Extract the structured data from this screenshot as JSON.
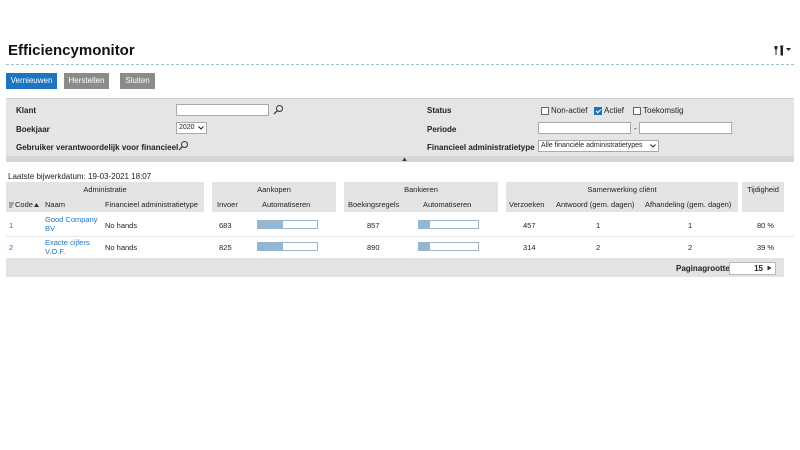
{
  "page": {
    "title": "Efficiencymonitor"
  },
  "toolbar": {
    "refresh_label": "Vernieuwen",
    "reset_label": "Herstellen",
    "close_label": "Sluiten"
  },
  "filters": {
    "client_label": "Klant",
    "client_value": "",
    "fiscal_year_label": "Boekjaar",
    "fiscal_year_value": "2020",
    "responsible_user_label": "Gebruiker verantwoordelijk voor financieel",
    "status_label": "Status",
    "status_options": [
      {
        "label": "Non-actief",
        "checked": false
      },
      {
        "label": "Actief",
        "checked": true
      },
      {
        "label": "Toekomstig",
        "checked": false
      }
    ],
    "period_label": "Periode",
    "period_from": "",
    "period_separator": "-",
    "period_to": "",
    "admin_type_label": "Financieel administratietype",
    "admin_type_value": "Alle financiële administratietypes"
  },
  "last_update": "Laatste bijwerkdatum: 19-03-2021 18:07",
  "table": {
    "groups": {
      "administratie": "Administratie",
      "aankopen": "Aankopen",
      "bankieren": "Bankieren",
      "samenwerking": "Samenwerking cliënt",
      "tijdigheid": "Tijdigheid"
    },
    "columns": {
      "code": "Code",
      "naam": "Naam",
      "fin_type": "Financieel administratietype",
      "invoer": "Invoer",
      "automatiseren_aankopen": "Automatiseren",
      "boekingsregels": "Boekingsregels",
      "automatiseren_bankieren": "Automatiseren",
      "verzoeken": "Verzoeken",
      "antwoord": "Antwoord (gem. dagen)",
      "afhandeling": "Afhandeling (gem. dagen)"
    },
    "rows": [
      {
        "code": "1",
        "naam_line1": "Good Company",
        "naam_line2": "BV",
        "fin_type": "No hands",
        "invoer": "683",
        "aankopen_auto": 0.42,
        "boekingsregels": "857",
        "bankieren_auto": 0.18,
        "verzoeken": "457",
        "antwoord": "1",
        "afhandeling": "1",
        "tijdigheid": "80 %"
      },
      {
        "code": "2",
        "naam_line1": "Exacte cijfers",
        "naam_line2": "V.O.F.",
        "fin_type": "No hands",
        "invoer": "825",
        "aankopen_auto": 0.42,
        "boekingsregels": "890",
        "bankieren_auto": 0.18,
        "verzoeken": "314",
        "antwoord": "2",
        "afhandeling": "2",
        "tijdigheid": "39 %"
      }
    ]
  },
  "pagination": {
    "label": "Paginagrootte",
    "value": "15"
  },
  "colors": {
    "primary": "#1d75c1",
    "button_grey": "#8b8b8b",
    "panel": "#e5e5e5",
    "bar_fill": "#8fb8d8"
  }
}
